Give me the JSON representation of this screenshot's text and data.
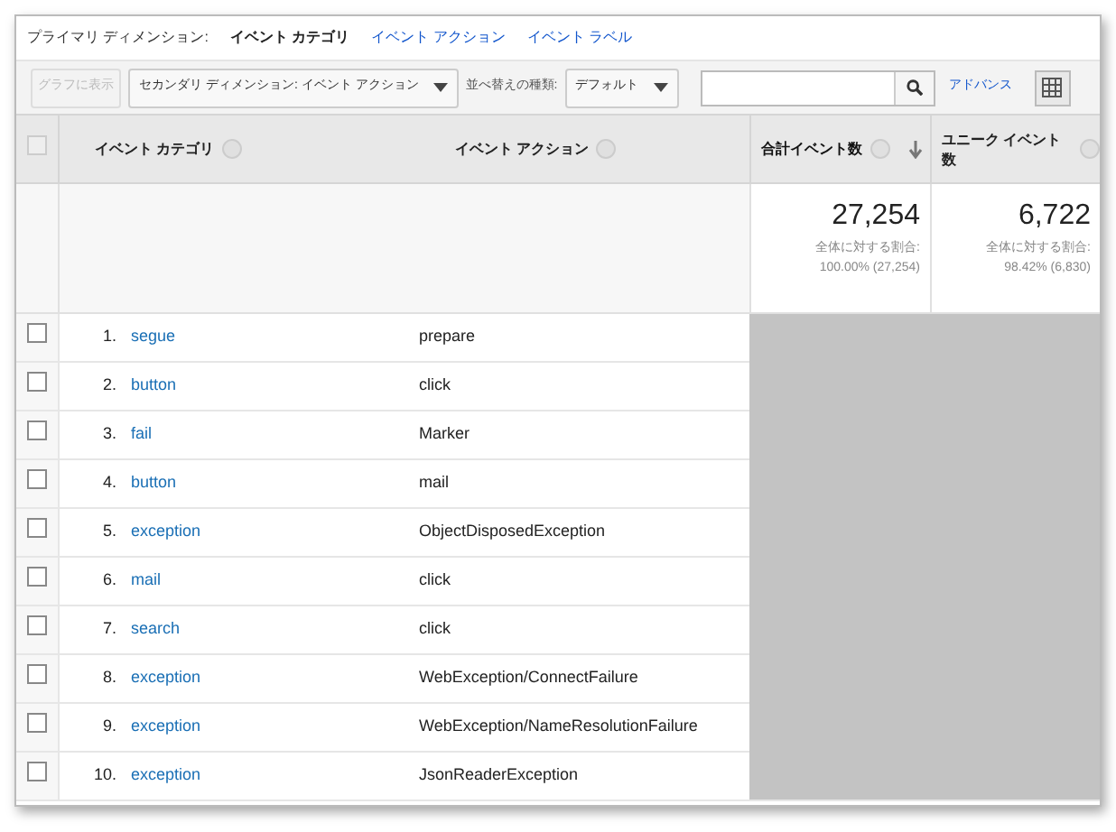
{
  "primary_dimension": {
    "label": "プライマリ ディメンション:",
    "options": [
      {
        "label": "イベント カテゴリ",
        "selected": true
      },
      {
        "label": "イベント アクション",
        "selected": false
      },
      {
        "label": "イベント ラベル",
        "selected": false
      }
    ]
  },
  "toolbar": {
    "chart_button": {
      "label": "グラフに表示",
      "disabled": true
    },
    "secondary_dimension": "セカンダリ ディメンション: イベント アクション",
    "sort_label": "並べ替えの種類:",
    "sort_type": "デフォルト",
    "advanced_link": "アドバンス"
  },
  "table": {
    "select_all_checked": false,
    "columns": [
      {
        "label": "イベント カテゴリ",
        "sorted": false
      },
      {
        "label": "イベント アクション",
        "sorted": false
      },
      {
        "label": "合計イベント数",
        "sorted": true
      },
      {
        "label": "ユニーク イベント数",
        "sorted": false
      }
    ],
    "totals": [
      {
        "value": "27,254",
        "share": "全体に対する割合: 100.00% (27,254)"
      },
      {
        "value": "6,722",
        "share": "全体に対する割合: 98.42% (6,830)"
      }
    ],
    "rows": [
      {
        "index": "1.",
        "category": "segue",
        "action": "prepare",
        "checked": false
      },
      {
        "index": "2.",
        "category": "button",
        "action": "click",
        "checked": false
      },
      {
        "index": "3.",
        "category": "fail",
        "action": "Marker",
        "checked": false
      },
      {
        "index": "4.",
        "category": "button",
        "action": "mail",
        "checked": false
      },
      {
        "index": "5.",
        "category": "exception",
        "action": "ObjectDisposedException",
        "checked": false
      },
      {
        "index": "6.",
        "category": "mail",
        "action": "click",
        "checked": false
      },
      {
        "index": "7.",
        "category": "search",
        "action": "click",
        "checked": false
      },
      {
        "index": "8.",
        "category": "exception",
        "action": "WebException/ConnectFailure",
        "checked": false
      },
      {
        "index": "9.",
        "category": "exception",
        "action": "WebException/NameResolutionFailure",
        "checked": false
      },
      {
        "index": "10.",
        "category": "exception",
        "action": "JsonReaderException",
        "checked": false
      }
    ]
  }
}
